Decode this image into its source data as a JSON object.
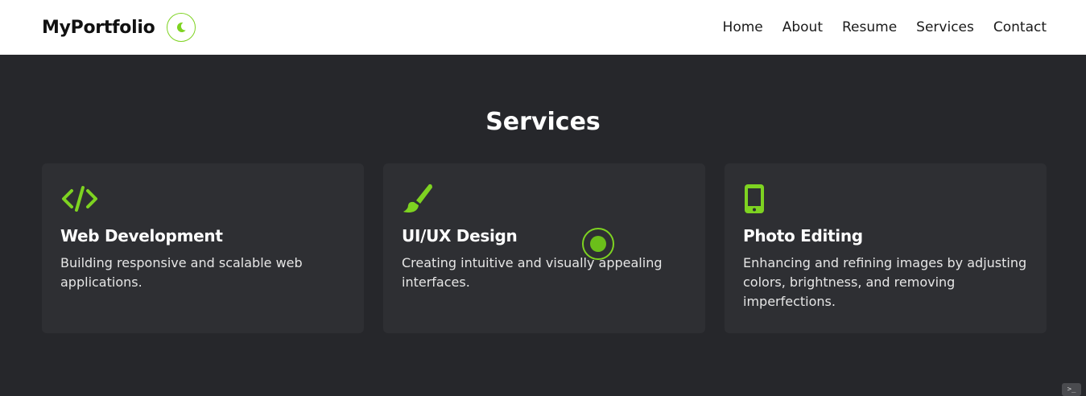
{
  "brand": "MyPortfolio",
  "nav": {
    "items": [
      "Home",
      "About",
      "Resume",
      "Services",
      "Contact"
    ]
  },
  "theme_toggle_icon": "moon-icon",
  "services": {
    "title": "Services",
    "cards": [
      {
        "icon": "code-icon",
        "title": "Web Development",
        "description": "Building responsive and scalable web applications."
      },
      {
        "icon": "paintbrush-icon",
        "title": "UI/UX Design",
        "description": "Creating intuitive and visually appealing interfaces."
      },
      {
        "icon": "mobile-icon",
        "title": "Photo Editing",
        "description": "Enhancing and refining images by adjusting colors, brightness, and removing imperfections."
      }
    ]
  },
  "colors": {
    "accent": "#7ed321",
    "background": "#26272b",
    "card": "#2e2f33",
    "navbar": "#ffffff"
  }
}
